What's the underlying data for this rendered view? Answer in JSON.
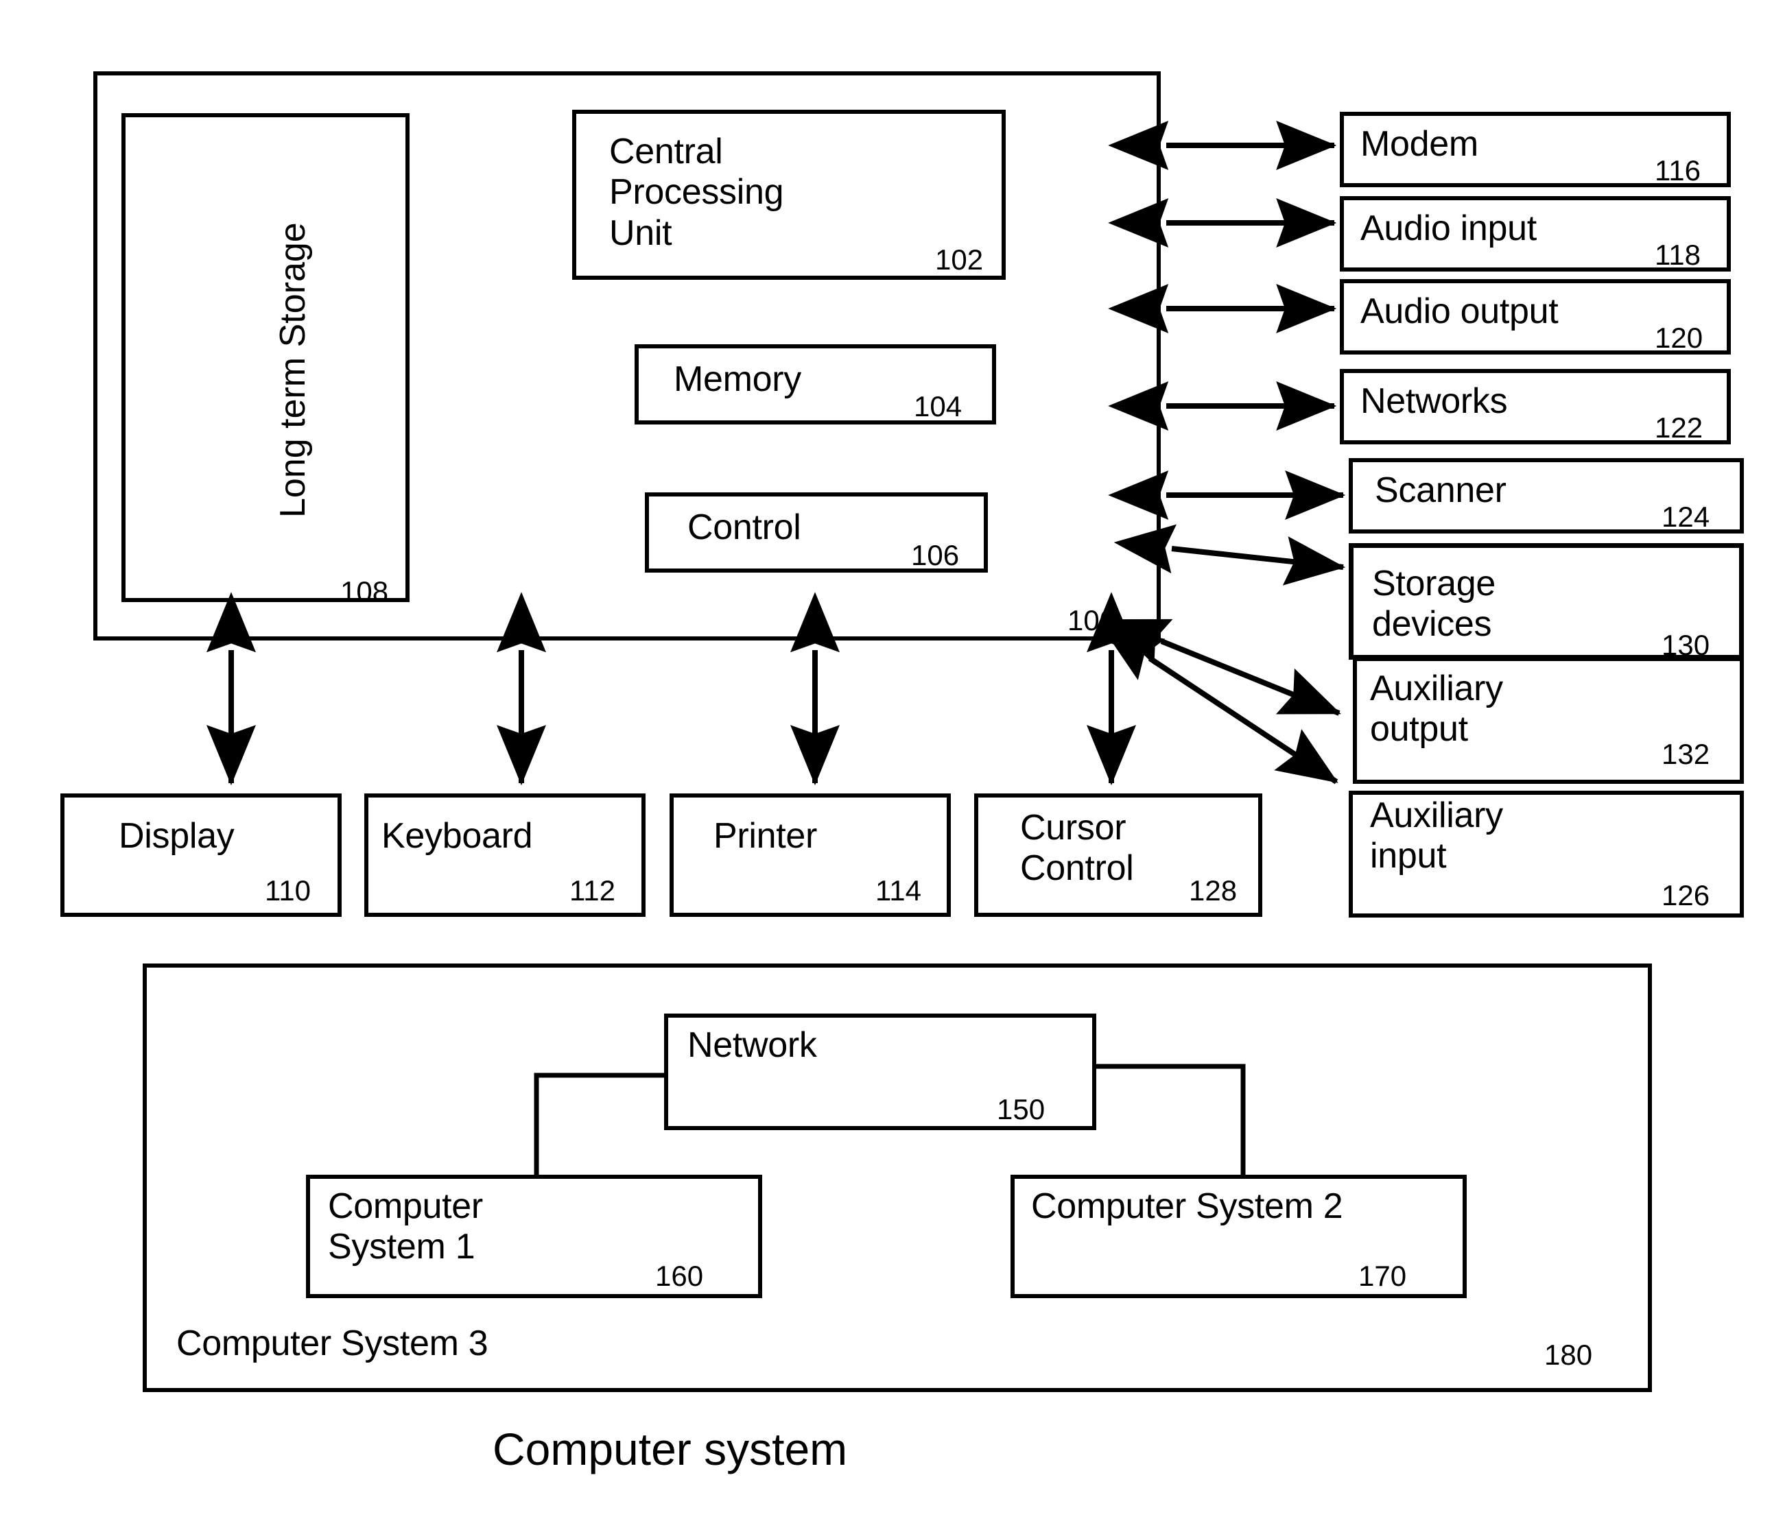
{
  "figure": {
    "caption": "Computer system"
  },
  "main_unit": {
    "ref": "100",
    "blocks": [
      {
        "name": "long_term_storage",
        "label": "Long term Storage",
        "ref": "108",
        "orientation": "vertical"
      },
      {
        "name": "central_processing_unit",
        "label": "Central\nProcessing\nUnit",
        "ref": "102",
        "orientation": "horizontal"
      },
      {
        "name": "memory",
        "label": "Memory",
        "ref": "104",
        "orientation": "horizontal"
      },
      {
        "name": "control",
        "label": "Control",
        "ref": "106",
        "orientation": "horizontal"
      }
    ]
  },
  "peripherals_right": [
    {
      "name": "modem",
      "label": "Modem",
      "ref": "116"
    },
    {
      "name": "audio_input",
      "label": "Audio input",
      "ref": "118"
    },
    {
      "name": "audio_output",
      "label": "Audio output",
      "ref": "120"
    },
    {
      "name": "networks",
      "label": "Networks",
      "ref": "122"
    },
    {
      "name": "scanner",
      "label": "Scanner",
      "ref": "124"
    },
    {
      "name": "storage_devices",
      "label": "Storage\ndevices",
      "ref": "130"
    },
    {
      "name": "auxiliary_output",
      "label": "Auxiliary\noutput",
      "ref": "132"
    },
    {
      "name": "auxiliary_input",
      "label": "Auxiliary\ninput",
      "ref": "126"
    }
  ],
  "peripherals_bottom": [
    {
      "name": "display",
      "label": "Display",
      "ref": "110"
    },
    {
      "name": "keyboard",
      "label": "Keyboard",
      "ref": "112"
    },
    {
      "name": "printer",
      "label": "Printer",
      "ref": "114"
    },
    {
      "name": "cursor_control",
      "label": "Cursor\nControl",
      "ref": "128"
    }
  ],
  "network_section": {
    "container": {
      "name": "computer_system_3",
      "label": "Computer System 3",
      "ref": "180"
    },
    "nodes": [
      {
        "name": "network",
        "label": "Network",
        "ref": "150"
      },
      {
        "name": "computer_system_1",
        "label": "Computer\nSystem 1",
        "ref": "160"
      },
      {
        "name": "computer_system_2",
        "label": "Computer System 2",
        "ref": "170"
      }
    ]
  },
  "colors": {
    "stroke": "#000000",
    "background": "#ffffff"
  }
}
